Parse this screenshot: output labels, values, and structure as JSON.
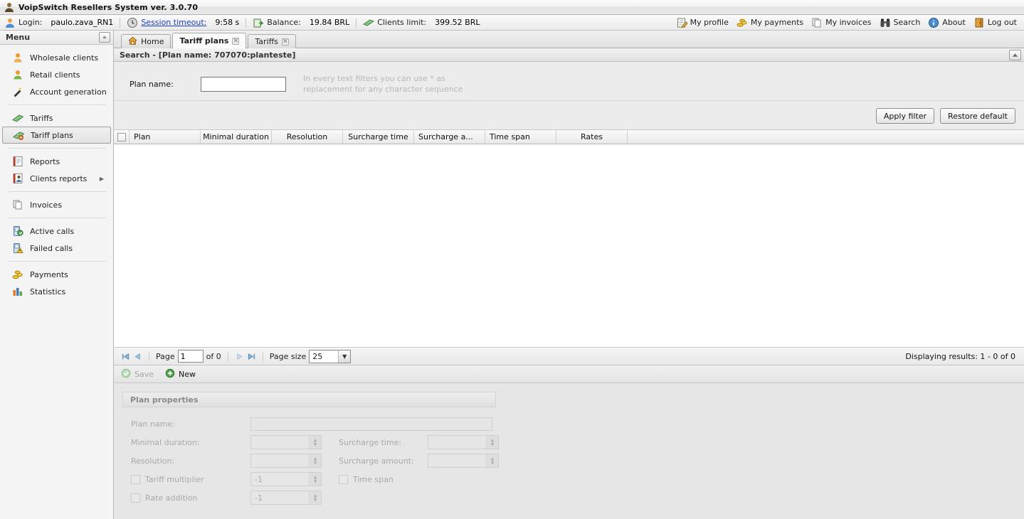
{
  "window": {
    "title": "VoipSwitch Resellers System ver. 3.0.70",
    "app_icon": "user-avatar-icon"
  },
  "infobar": {
    "login_label": "Login:",
    "login_value": "paulo.zava_RN1",
    "session_label": "Session timeout:",
    "session_value": "9:58 s",
    "balance_label": "Balance:",
    "balance_value": "19.84 BRL",
    "clients_limit_label": "Clients limit:",
    "clients_limit_value": "399.52 BRL",
    "nav": [
      {
        "label": "My profile",
        "icon": "profile-icon"
      },
      {
        "label": "My payments",
        "icon": "coins-icon"
      },
      {
        "label": "My invoices",
        "icon": "documents-icon"
      },
      {
        "label": "Search",
        "icon": "binoculars-icon"
      },
      {
        "label": "About",
        "icon": "info-icon"
      },
      {
        "label": "Log out",
        "icon": "door-icon"
      }
    ]
  },
  "sidebar": {
    "title": "Menu",
    "collapse_icon": "chevron-double-left-icon",
    "items": [
      {
        "label": "Wholesale clients",
        "icon": "user-orange-icon",
        "selected": false,
        "submenu": false
      },
      {
        "label": "Retail clients",
        "icon": "user-green-icon",
        "selected": false,
        "submenu": false
      },
      {
        "label": "Account generation",
        "icon": "magic-wand-icon",
        "selected": false,
        "submenu": false
      },
      {
        "label": "Tariffs",
        "icon": "money-icon",
        "selected": false,
        "submenu": false
      },
      {
        "label": "Tariff plans",
        "icon": "money-plan-icon",
        "selected": true,
        "submenu": false
      },
      {
        "label": "Reports",
        "icon": "report-icon",
        "selected": false,
        "submenu": false
      },
      {
        "label": "Clients reports",
        "icon": "clients-report-icon",
        "selected": false,
        "submenu": true
      },
      {
        "label": "Invoices",
        "icon": "invoices-icon",
        "selected": false,
        "submenu": false
      },
      {
        "label": "Active calls",
        "icon": "phone-active-icon",
        "selected": false,
        "submenu": false
      },
      {
        "label": "Failed calls",
        "icon": "phone-failed-icon",
        "selected": false,
        "submenu": false
      },
      {
        "label": "Payments",
        "icon": "coins-icon",
        "selected": false,
        "submenu": false
      },
      {
        "label": "Statistics",
        "icon": "bar-chart-icon",
        "selected": false,
        "submenu": false
      }
    ]
  },
  "tabs": [
    {
      "label": "Home",
      "icon": "home-icon",
      "active": false,
      "closable": false
    },
    {
      "label": "Tariff plans",
      "icon": "",
      "active": true,
      "closable": true
    },
    {
      "label": "Tariffs",
      "icon": "",
      "active": false,
      "closable": true
    }
  ],
  "search_panel": {
    "title": "Search - [Plan name: 707070:planteste]",
    "collapse_icon": "triangle-up-icon",
    "plan_name_label": "Plan name:",
    "plan_name_value": "",
    "plan_name_placeholder": "",
    "hint": "In every text filters you can use * as replacement for any character sequence",
    "apply_label": "Apply filter",
    "restore_label": "Restore default"
  },
  "grid": {
    "columns": [
      {
        "label": "Plan",
        "width": 100,
        "align": "left"
      },
      {
        "label": "Minimal duration",
        "width": 100,
        "align": "center"
      },
      {
        "label": "Resolution",
        "width": 100,
        "align": "center"
      },
      {
        "label": "Surcharge time",
        "width": 100,
        "align": "center"
      },
      {
        "label": "Surcharge a...",
        "width": 100,
        "align": "left"
      },
      {
        "label": "Time span",
        "width": 100,
        "align": "left"
      },
      {
        "label": "Rates",
        "width": 100,
        "align": "center"
      }
    ],
    "rows": []
  },
  "pager": {
    "first_icon": "first-page-icon",
    "prev_icon": "prev-page-icon",
    "next_icon": "next-page-icon",
    "last_icon": "last-page-icon",
    "page_label": "Page",
    "page_value": "1",
    "of_label": "of 0",
    "page_size_label": "Page size",
    "page_size_value": "25",
    "results": "Displaying results: 1 - 0 of 0"
  },
  "toolbar": {
    "save_label": "Save",
    "save_icon": "check-circle-icon",
    "new_label": "New",
    "new_icon": "plus-circle-icon"
  },
  "properties": {
    "title": "Plan properties",
    "plan_name_label": "Plan name:",
    "plan_name_value": "",
    "minimal_duration_label": "Minimal duration:",
    "minimal_duration_value": "",
    "resolution_label": "Resolution:",
    "resolution_value": "",
    "surcharge_time_label": "Surcharge time:",
    "surcharge_time_value": "",
    "surcharge_amount_label": "Surcharge amount:",
    "surcharge_amount_value": "",
    "tariff_multiplier_label": "Tariff multiplier",
    "tariff_multiplier_value": "-1",
    "rate_addition_label": "Rate addition",
    "rate_addition_value": "-1",
    "time_span_label": "Time span"
  },
  "colors": {
    "link": "#1a3fc4",
    "accent_green": "#4fa34f",
    "window_bg": "#e6e6e6",
    "panel_bg": "#ececec"
  }
}
